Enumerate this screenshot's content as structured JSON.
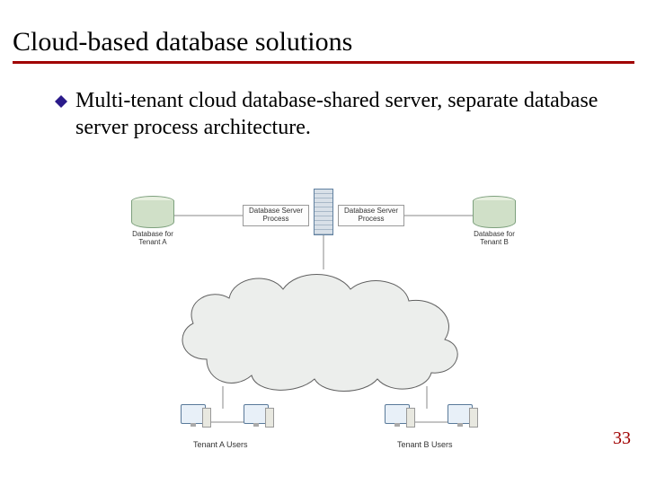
{
  "title": "Cloud-based database solutions",
  "bullet": "Multi-tenant cloud database-shared server, separate database server process architecture.",
  "page_number": "33",
  "diagram": {
    "db_left_label": "Database for Tenant A",
    "db_right_label": "Database for Tenant B",
    "proc_left": "Database Server Process",
    "proc_right": "Database Server Process",
    "users_left": "Tenant A Users",
    "users_right": "Tenant B Users"
  }
}
